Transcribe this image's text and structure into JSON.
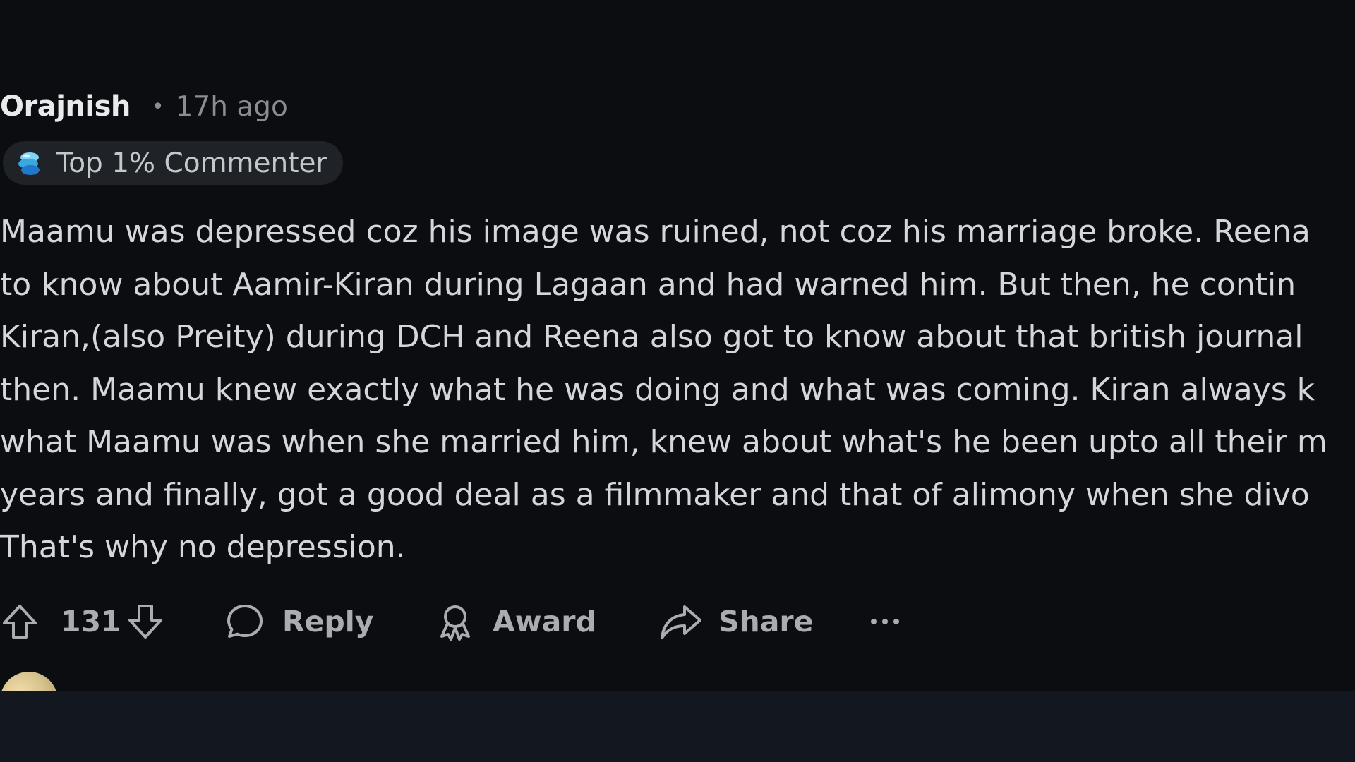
{
  "comment": {
    "author": "Orajnish",
    "separator": "•",
    "timestamp": "17h ago",
    "flair": {
      "icon": "top-commenter-badge-icon",
      "label": "Top 1% Commenter"
    },
    "body_lines": [
      "Maamu was depressed coz his image was ruined, not coz his marriage broke. Reena",
      "to know about Aamir-Kiran during Lagaan and had warned him. But then, he contin",
      "Kiran,(also Preity) during DCH and Reena also got to know about that british journal",
      "then. Maamu knew exactly what he was doing and what was coming. Kiran always k",
      "what Maamu was when she married him, knew about what's he been upto all their m",
      "years and finally, got a good deal as a filmmaker and that of alimony when she divo",
      "That's why no depression."
    ],
    "actions": {
      "upvote_icon": "upvote-arrow-icon",
      "vote_count": "131",
      "downvote_icon": "downvote-arrow-icon",
      "reply_icon": "speech-bubble-icon",
      "reply_label": "Reply",
      "award_icon": "award-ribbon-icon",
      "award_label": "Award",
      "share_icon": "share-arrow-icon",
      "share_label": "Share",
      "more_icon": "ellipsis-icon"
    }
  },
  "colors": {
    "background": "#0b0d10",
    "text": "#d4d6d9",
    "muted": "#8a8d91",
    "action": "#a9acb0",
    "flair_bg": "#1f2226"
  }
}
